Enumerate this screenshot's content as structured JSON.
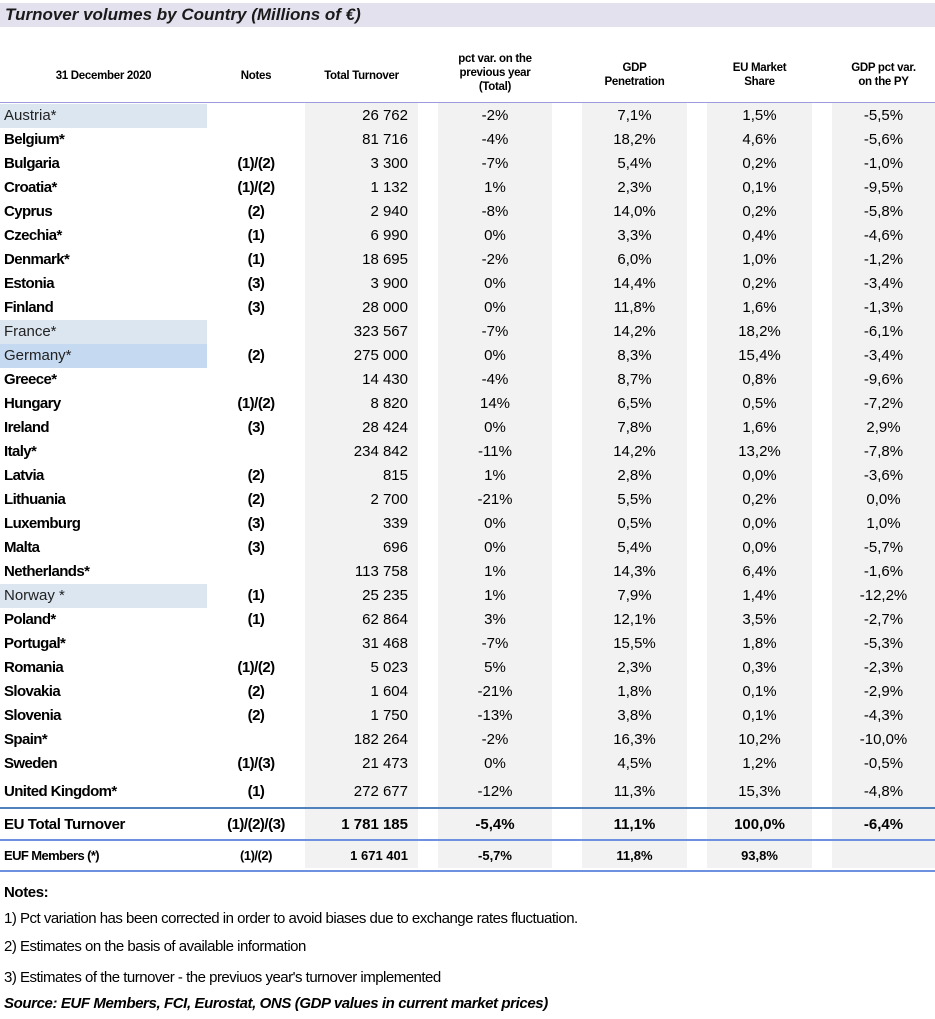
{
  "title": "Turnover volumes by Country (Millions of €)",
  "headers": {
    "date": "31 December 2020",
    "notes": "Notes",
    "total_turnover": "Total Turnover",
    "pct_var": [
      "pct var. on the",
      "previous year",
      "(Total)"
    ],
    "gdp_penetration": [
      "GDP",
      "Penetration"
    ],
    "eu_market_share": [
      "EU Market",
      "Share"
    ],
    "gdp_pct_var": [
      "GDP pct var.",
      "on the PY"
    ]
  },
  "colors": {
    "title_bg": "#e4e1ee",
    "highlight_light": "#dce6f1",
    "highlight_strong": "#c5d9f1",
    "data_column_bg": "#f2f2f2",
    "rule": "#6f8fe0"
  },
  "rows": [
    {
      "country": "Austria*",
      "notes": "",
      "turnover": "26 762",
      "pct": "-2%",
      "gdp": "7,1%",
      "share": "1,5%",
      "gdpvar": "-5,5%",
      "highlight": "light"
    },
    {
      "country": "Belgium*",
      "notes": "",
      "turnover": "81 716",
      "pct": "-4%",
      "gdp": "18,2%",
      "share": "4,6%",
      "gdpvar": "-5,6%"
    },
    {
      "country": "Bulgaria",
      "notes": "(1)/(2)",
      "turnover": "3 300",
      "pct": "-7%",
      "gdp": "5,4%",
      "share": "0,2%",
      "gdpvar": "-1,0%"
    },
    {
      "country": "Croatia*",
      "notes": "(1)/(2)",
      "turnover": "1 132",
      "pct": "1%",
      "gdp": "2,3%",
      "share": "0,1%",
      "gdpvar": "-9,5%"
    },
    {
      "country": "Cyprus",
      "notes": "(2)",
      "turnover": "2 940",
      "pct": "-8%",
      "gdp": "14,0%",
      "share": "0,2%",
      "gdpvar": "-5,8%"
    },
    {
      "country": "Czechia*",
      "notes": "(1)",
      "turnover": "6 990",
      "pct": "0%",
      "gdp": "3,3%",
      "share": "0,4%",
      "gdpvar": "-4,6%"
    },
    {
      "country": "Denmark*",
      "notes": "(1)",
      "turnover": "18 695",
      "pct": "-2%",
      "gdp": "6,0%",
      "share": "1,0%",
      "gdpvar": "-1,2%"
    },
    {
      "country": "Estonia",
      "notes": "(3)",
      "turnover": "3 900",
      "pct": "0%",
      "gdp": "14,4%",
      "share": "0,2%",
      "gdpvar": "-3,4%"
    },
    {
      "country": "Finland",
      "notes": "(3)",
      "turnover": "28 000",
      "pct": "0%",
      "gdp": "11,8%",
      "share": "1,6%",
      "gdpvar": "-1,3%"
    },
    {
      "country": "France*",
      "notes": "",
      "turnover": "323 567",
      "pct": "-7%",
      "gdp": "14,2%",
      "share": "18,2%",
      "gdpvar": "-6,1%",
      "highlight": "light"
    },
    {
      "country": "Germany*",
      "notes": "(2)",
      "turnover": "275 000",
      "pct": "0%",
      "gdp": "8,3%",
      "share": "15,4%",
      "gdpvar": "-3,4%",
      "highlight": "strong"
    },
    {
      "country": "Greece*",
      "notes": "",
      "turnover": "14 430",
      "pct": "-4%",
      "gdp": "8,7%",
      "share": "0,8%",
      "gdpvar": "-9,6%"
    },
    {
      "country": "Hungary",
      "notes": "(1)/(2)",
      "turnover": "8 820",
      "pct": "14%",
      "gdp": "6,5%",
      "share": "0,5%",
      "gdpvar": "-7,2%"
    },
    {
      "country": "Ireland",
      "notes": "(3)",
      "turnover": "28 424",
      "pct": "0%",
      "gdp": "7,8%",
      "share": "1,6%",
      "gdpvar": "2,9%"
    },
    {
      "country": "Italy*",
      "notes": "",
      "turnover": "234 842",
      "pct": "-11%",
      "gdp": "14,2%",
      "share": "13,2%",
      "gdpvar": "-7,8%"
    },
    {
      "country": "Latvia",
      "notes": "(2)",
      "turnover": "815",
      "pct": "1%",
      "gdp": "2,8%",
      "share": "0,0%",
      "gdpvar": "-3,6%"
    },
    {
      "country": "Lithuania",
      "notes": "(2)",
      "turnover": "2 700",
      "pct": "-21%",
      "gdp": "5,5%",
      "share": "0,2%",
      "gdpvar": "0,0%"
    },
    {
      "country": "Luxemburg",
      "notes": "(3)",
      "turnover": "339",
      "pct": "0%",
      "gdp": "0,5%",
      "share": "0,0%",
      "gdpvar": "1,0%"
    },
    {
      "country": "Malta",
      "notes": "(3)",
      "turnover": "696",
      "pct": "0%",
      "gdp": "5,4%",
      "share": "0,0%",
      "gdpvar": "-5,7%"
    },
    {
      "country": "Netherlands*",
      "notes": "",
      "turnover": "113 758",
      "pct": "1%",
      "gdp": "14,3%",
      "share": "6,4%",
      "gdpvar": "-1,6%"
    },
    {
      "country": "Norway *",
      "notes": "(1)",
      "turnover": "25 235",
      "pct": "1%",
      "gdp": "7,9%",
      "share": "1,4%",
      "gdpvar": "-12,2%",
      "highlight": "light"
    },
    {
      "country": "Poland*",
      "notes": "(1)",
      "turnover": "62 864",
      "pct": "3%",
      "gdp": "12,1%",
      "share": "3,5%",
      "gdpvar": "-2,7%"
    },
    {
      "country": "Portugal*",
      "notes": "",
      "turnover": "31 468",
      "pct": "-7%",
      "gdp": "15,5%",
      "share": "1,8%",
      "gdpvar": "-5,3%"
    },
    {
      "country": "Romania",
      "notes": "(1)/(2)",
      "turnover": "5 023",
      "pct": "5%",
      "gdp": "2,3%",
      "share": "0,3%",
      "gdpvar": "-2,3%"
    },
    {
      "country": "Slovakia",
      "notes": "(2)",
      "turnover": "1 604",
      "pct": "-21%",
      "gdp": "1,8%",
      "share": "0,1%",
      "gdpvar": "-2,9%"
    },
    {
      "country": "Slovenia",
      "notes": "(2)",
      "turnover": "1 750",
      "pct": "-13%",
      "gdp": "3,8%",
      "share": "0,1%",
      "gdpvar": "-4,3%"
    },
    {
      "country": "Spain*",
      "notes": "",
      "turnover": "182 264",
      "pct": "-2%",
      "gdp": "16,3%",
      "share": "10,2%",
      "gdpvar": "-10,0%"
    },
    {
      "country": "Sweden",
      "notes": "(1)/(3)",
      "turnover": "21 473",
      "pct": "0%",
      "gdp": "4,5%",
      "share": "1,2%",
      "gdpvar": "-0,5%"
    },
    {
      "country": "United Kingdom*",
      "notes": "(1)",
      "turnover": "272 677",
      "pct": "-12%",
      "gdp": "11,3%",
      "share": "15,3%",
      "gdpvar": "-4,8%"
    }
  ],
  "total": {
    "country": "EU Total Turnover",
    "notes": "(1)/(2)/(3)",
    "turnover": "1 781 185",
    "pct": "-5,4%",
    "gdp": "11,1%",
    "share": "100,0%",
    "gdpvar": "-6,4%"
  },
  "euf": {
    "country": "EUF Members (*)",
    "notes": "(1)/(2)",
    "turnover": "1 671 401",
    "pct": "-5,7%",
    "gdp": "11,8%",
    "share": "93,8%",
    "gdpvar": ""
  },
  "footnotes": {
    "title": "Notes:",
    "lines": [
      "1) Pct variation has been corrected in order to avoid biases due to exchange rates fluctuation.",
      "2) Estimates on the basis of available information",
      "3) Estimates of the turnover - the previuos year's turnover implemented"
    ],
    "source": "Source: EUF Members, FCI, Eurostat, ONS (GDP values in current market prices)"
  }
}
